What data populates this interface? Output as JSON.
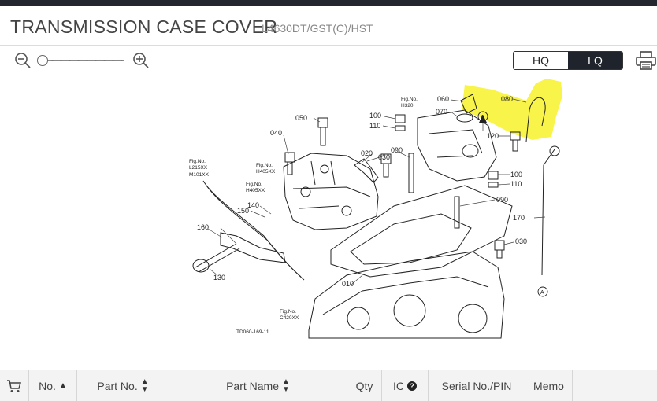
{
  "header": {
    "title": "TRANSMISSION CASE COVER",
    "model": "L4630DT/GST(C)/HST"
  },
  "toolbar": {
    "quality_hq": "HQ",
    "quality_lq": "LQ",
    "selected_quality": "LQ",
    "zoom_level": 0
  },
  "diagram": {
    "code": "TD060-169-11",
    "callouts": {
      "c010": "010",
      "c020": "020",
      "c030a": "030",
      "c030b": "030",
      "c040": "040",
      "c050": "050",
      "c060": "060",
      "c070": "070",
      "c080": "080",
      "c090a": "090",
      "c090b": "090",
      "c100a": "100",
      "c100b": "100",
      "c110a": "110",
      "c110b": "110",
      "c120": "120",
      "c130": "130",
      "c140": "140",
      "c150": "150",
      "c160": "160",
      "c170": "170",
      "arrowA1": "A",
      "arrowA2": "A"
    },
    "figrefs": {
      "h320a": "Fig.No.",
      "h320b": "H320",
      "l215a": "Fig.No.",
      "l215b": "L215XX",
      "l215c": "M101XX",
      "h405a": "Fig.No.",
      "h405b": "H405XX",
      "h405c": "Fig.No.",
      "h405d": "H405XX",
      "c420a": "Fig.No.",
      "c420b": "C420XX"
    },
    "highlight_color": "#f7f22a"
  },
  "table": {
    "columns": [
      "No.",
      "Part No.",
      "Part Name",
      "Qty",
      "IC",
      "Serial No./PIN",
      "Memo"
    ]
  }
}
